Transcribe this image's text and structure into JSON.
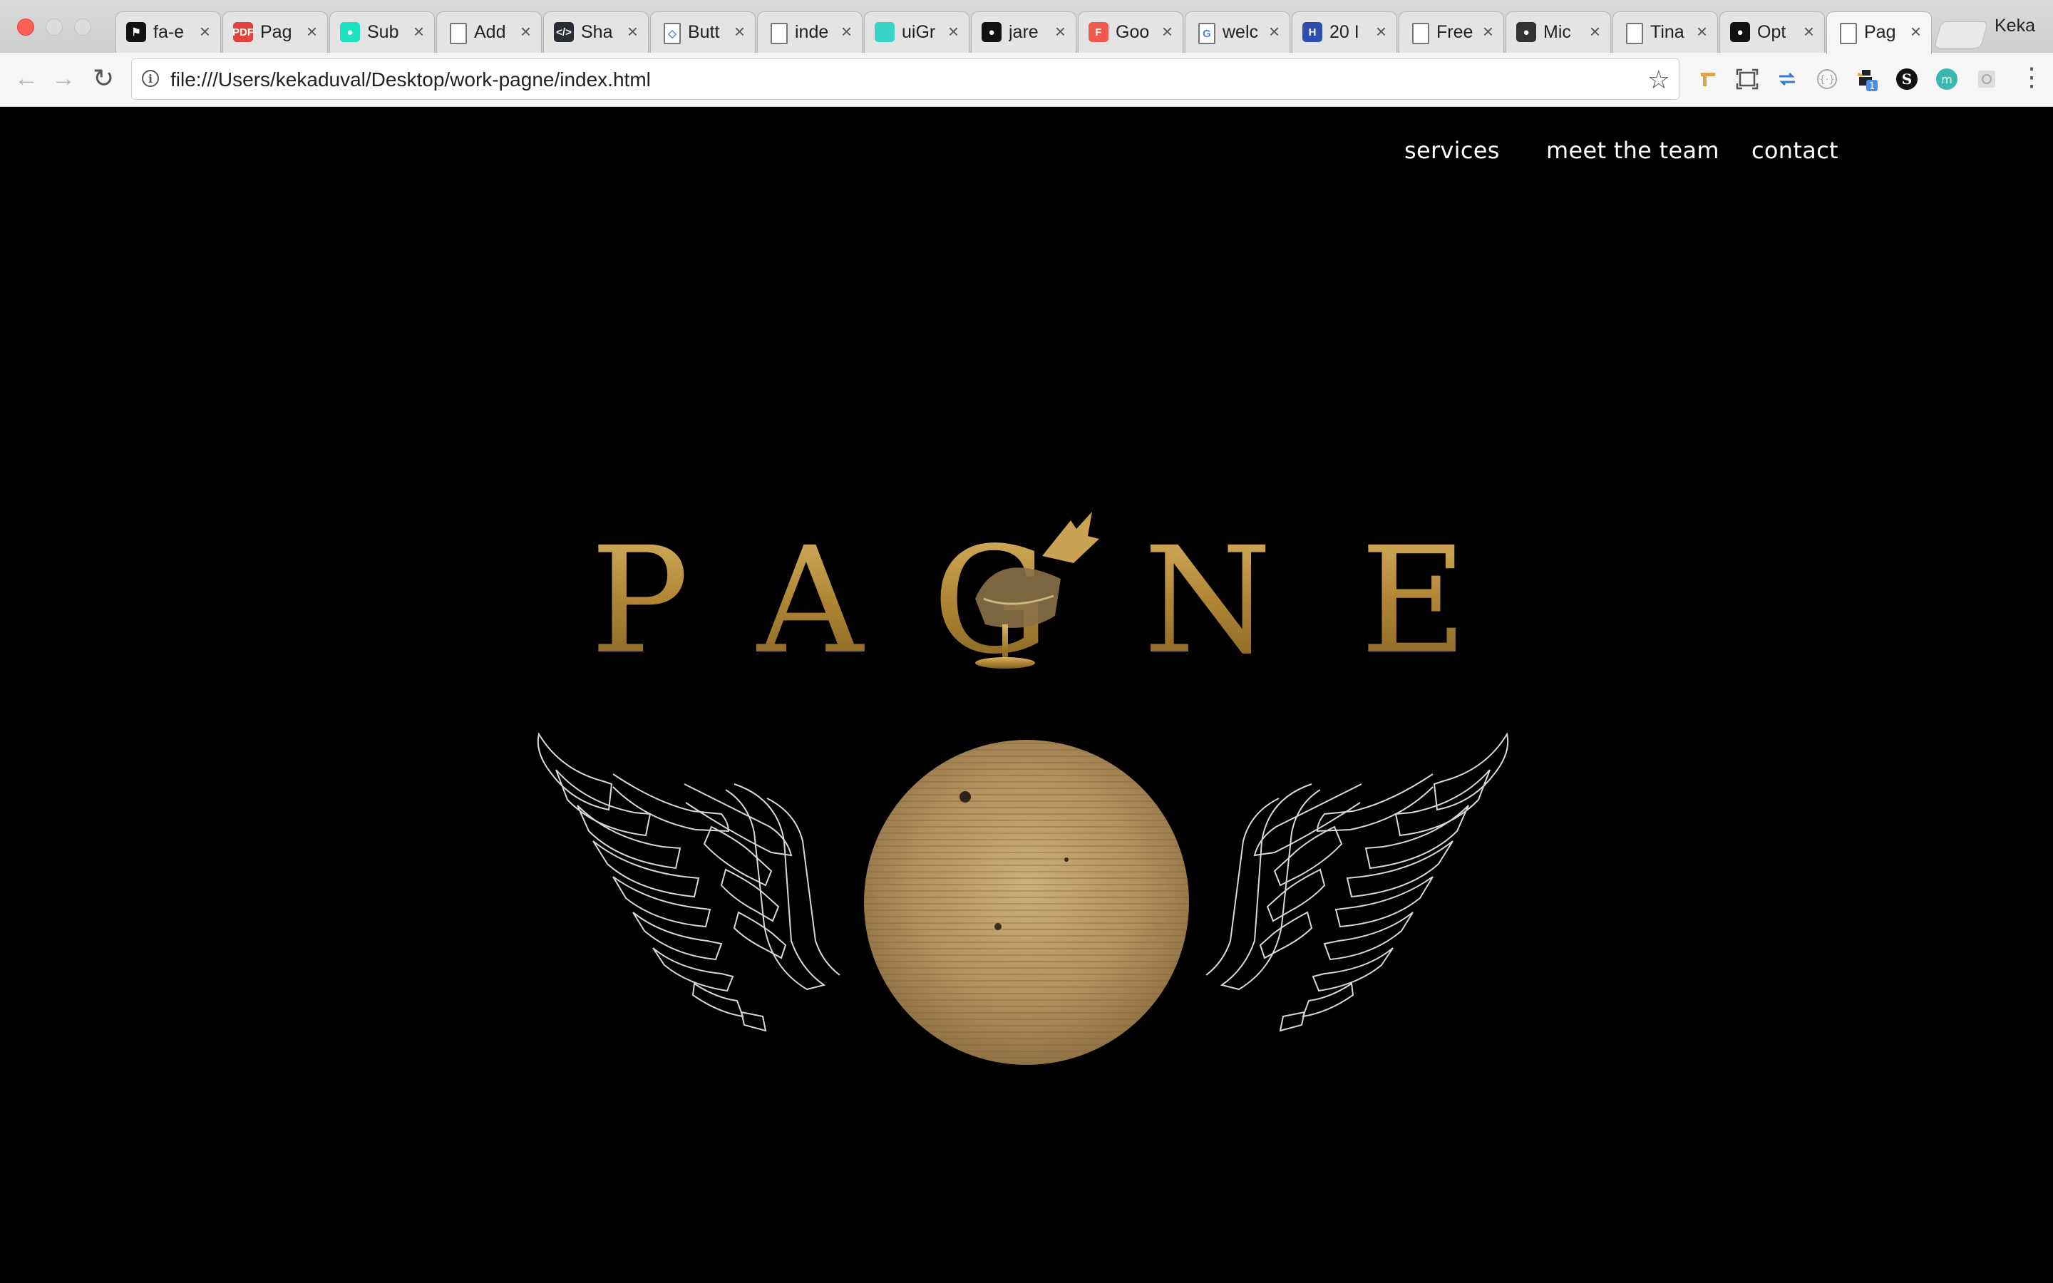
{
  "browser": {
    "tabs": [
      {
        "label": "fa-e",
        "icon": "flag-icon",
        "color": "#111111",
        "glyph": "⚑"
      },
      {
        "label": "Pag",
        "icon": "pdf-icon",
        "color": "#e0443e",
        "glyph": "PDF"
      },
      {
        "label": "Sub",
        "icon": "balloon-icon",
        "color": "#1de3c3",
        "glyph": "●"
      },
      {
        "label": "Add",
        "icon": "page-icon",
        "color": "#ffffff",
        "glyph": ""
      },
      {
        "label": "Sha",
        "icon": "code-icon",
        "color": "#2b2d35",
        "glyph": "</>"
      },
      {
        "label": "Butt",
        "icon": "codepen-icon",
        "color": "#ffffff",
        "glyph": "◇"
      },
      {
        "label": "inde",
        "icon": "page-icon",
        "color": "#ffffff",
        "glyph": ""
      },
      {
        "label": "uiGr",
        "icon": "gradient-icon",
        "color": "#39d4c8",
        "glyph": ""
      },
      {
        "label": "jare",
        "icon": "github-icon",
        "color": "#111111",
        "glyph": "●"
      },
      {
        "label": "Goo",
        "icon": "font-icon",
        "color": "#f05a4d",
        "glyph": "F"
      },
      {
        "label": "welc",
        "icon": "google-icon",
        "color": "#ffffff",
        "glyph": "G"
      },
      {
        "label": "20 I",
        "icon": "h-icon",
        "color": "#2d4fb0",
        "glyph": "H"
      },
      {
        "label": "Free",
        "icon": "page-icon",
        "color": "#ffffff",
        "glyph": ""
      },
      {
        "label": "Mic",
        "icon": "avatar-icon",
        "color": "#333333",
        "glyph": "●"
      },
      {
        "label": "Tina",
        "icon": "page-icon",
        "color": "#ffffff",
        "glyph": ""
      },
      {
        "label": "Opt",
        "icon": "github-icon",
        "color": "#111111",
        "glyph": "●"
      },
      {
        "label": "Pag",
        "icon": "page-icon",
        "color": "#ffffff",
        "glyph": "",
        "active": true
      }
    ],
    "profile_name": "Keka",
    "url": "file:///Users/kekaduval/Desktop/work-pagne/index.html",
    "extensions": [
      "tools-icon",
      "screen-capture-icon",
      "arrows-icon",
      "bracket-icon",
      "notification-icon",
      "s-icon",
      "m-icon",
      "puzzle-icon"
    ],
    "extension_badge": "1"
  },
  "site": {
    "nav": {
      "services": "services",
      "team": "meet the team",
      "contact": "contact"
    },
    "logo": {
      "letters": [
        "P",
        "A",
        "G",
        "N",
        "E"
      ],
      "gold": "#b8913f",
      "emblem": "winged-sphere-icon"
    }
  }
}
